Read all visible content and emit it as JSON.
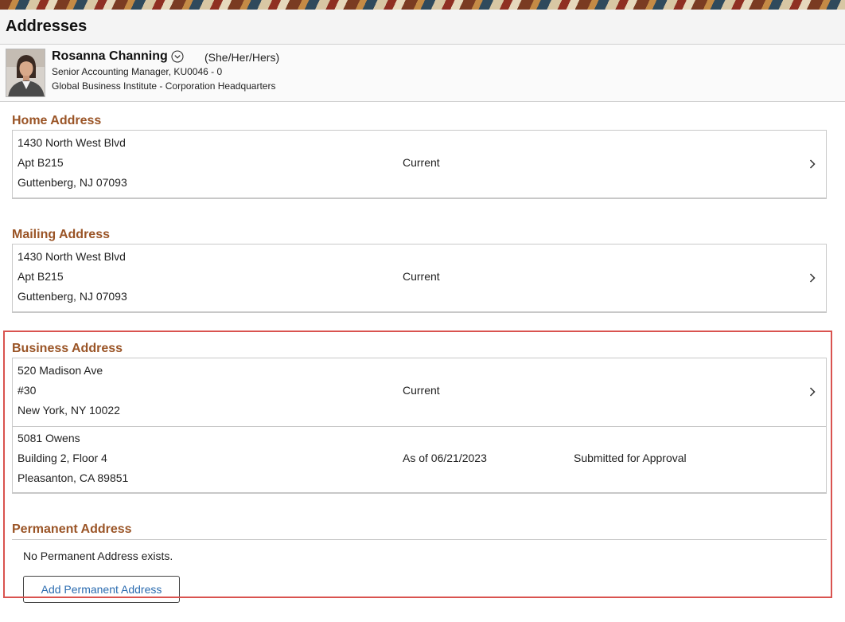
{
  "page": {
    "title": "Addresses"
  },
  "person": {
    "name": "Rosanna Channing",
    "pronouns": "(She/Her/Hers)",
    "job": "Senior Accounting Manager, KU0046 - 0",
    "organization": "Global Business Institute - Corporation Headquarters",
    "toggle_icon": "chevron-circle-down-icon"
  },
  "sections": {
    "home": {
      "title": "Home Address",
      "rows": [
        {
          "lines": [
            "1430 North West Blvd",
            "Apt B215",
            "Guttenberg, NJ 07093"
          ],
          "status": "Current"
        }
      ]
    },
    "mailing": {
      "title": "Mailing Address",
      "rows": [
        {
          "lines": [
            "1430 North West Blvd",
            "Apt B215",
            "Guttenberg, NJ 07093"
          ],
          "status": "Current"
        }
      ]
    },
    "business": {
      "title": "Business Address",
      "rows": [
        {
          "lines": [
            "520 Madison Ave",
            "#30",
            "New York, NY 10022"
          ],
          "status": "Current"
        },
        {
          "lines": [
            "5081 Owens",
            "Building 2, Floor 4",
            "Pleasanton, CA 89851"
          ],
          "status": "As of 06/21/2023",
          "approval": "Submitted for Approval"
        }
      ]
    },
    "permanent": {
      "title": "Permanent Address",
      "empty_message": "No Permanent Address exists.",
      "add_button_label": "Add Permanent Address"
    }
  },
  "colors": {
    "section_title": "#9a5426",
    "highlight_border": "#d9534f",
    "link_blue": "#2b6cb0"
  }
}
